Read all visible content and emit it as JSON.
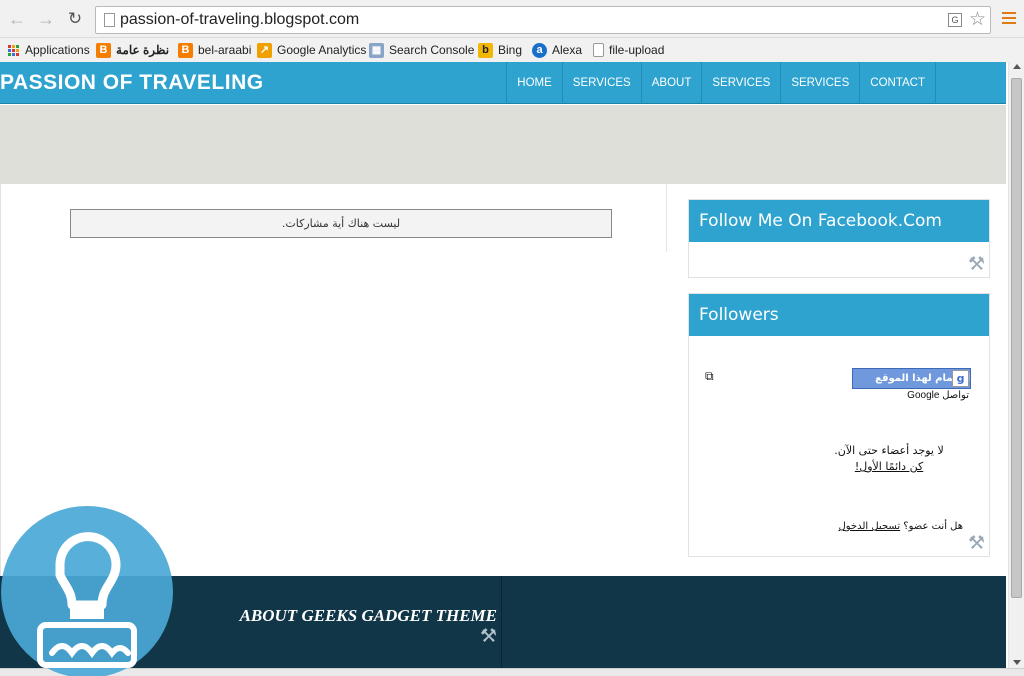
{
  "browser": {
    "url": "passion-of-traveling.blogspot.com",
    "icons": {
      "back": "back-arrow-icon",
      "forward": "forward-arrow-icon",
      "reload": "reload-icon",
      "page": "page-icon",
      "translate": "translate-icon",
      "bookmark_star": "star-icon",
      "menu": "menu-icon"
    }
  },
  "bookmarks": [
    {
      "label": "Applications",
      "icon": "apps-grid-icon"
    },
    {
      "label": "نظرة عامة",
      "icon": "blogger-icon"
    },
    {
      "label": "bel-araabi",
      "icon": "blogger-icon"
    },
    {
      "label": "Google Analytics",
      "icon": "analytics-icon"
    },
    {
      "label": "Search Console",
      "icon": "search-console-icon"
    },
    {
      "label": "Bing",
      "icon": "bing-icon"
    },
    {
      "label": "Alexa",
      "icon": "alexa-icon"
    },
    {
      "label": "file-upload",
      "icon": "file-icon"
    }
  ],
  "site": {
    "title": "PASSION OF TRAVELING",
    "nav": [
      "HOME",
      "SERVICES",
      "ABOUT",
      "SERVICES",
      "SERVICES",
      "CONTACT"
    ],
    "no_posts": "ليست هناك أية مشاركات.",
    "facebook_widget_title": "Follow Me On Facebook.Com",
    "followers_widget_title": "Followers",
    "join_button": "انضمام لهذا الموقع",
    "gfc_brand": "تواصل Google",
    "no_members": "لا يوجد أعضاء حتى الآن.",
    "be_first": "كن دائمًا الأول!",
    "already_member": "هل أنت عضو؟",
    "sign_in": "تسجيل الدخول",
    "footer_title": "ABOUT GEEKS GADGET THEME"
  },
  "colors": {
    "header_blue": "#2ea3cf",
    "banner_grey": "#dfdfd9",
    "footer_navy": "#113647",
    "watermark_blue": "#4aa8d6"
  }
}
